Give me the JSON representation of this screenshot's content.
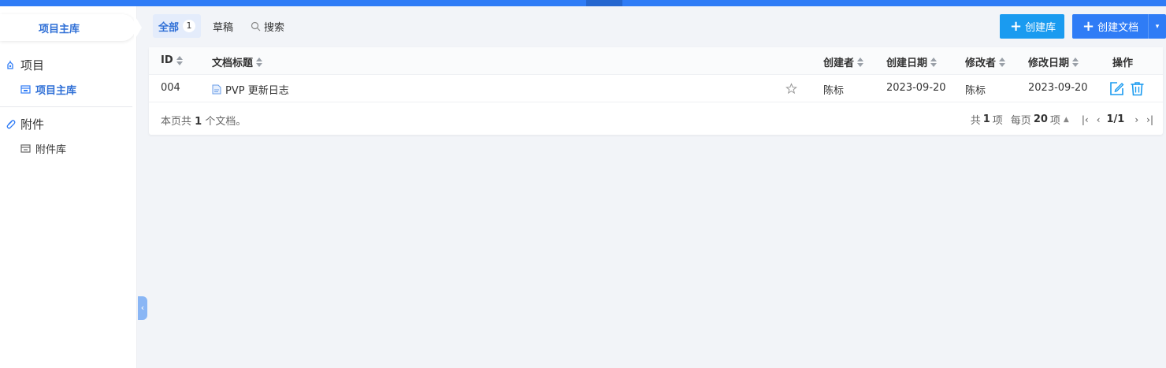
{
  "colors": {
    "accent": "#2f7cf6",
    "link": "#2f6fd6",
    "button": "#1a9bf0"
  },
  "sidebar": {
    "library_tab": "项目主库",
    "groups": [
      {
        "label": "项目",
        "icon": "project-icon",
        "items": [
          {
            "label": "项目主库",
            "icon": "library-icon",
            "active": true
          }
        ]
      },
      {
        "label": "附件",
        "icon": "paperclip-icon",
        "items": [
          {
            "label": "附件库",
            "icon": "attachment-library-icon",
            "active": false
          }
        ]
      }
    ],
    "collapse_glyph": "‹"
  },
  "tabs": [
    {
      "label": "全部",
      "count": "1",
      "active": true
    },
    {
      "label": "草稿"
    },
    {
      "label": "搜索",
      "icon": "search-icon"
    }
  ],
  "buttons": {
    "create_library": "创建库",
    "create_doc": "创建文档",
    "plus": "+",
    "dropdown": "▾"
  },
  "table": {
    "columns": [
      "ID",
      "文档标题",
      "创建者",
      "创建日期",
      "修改者",
      "修改日期",
      "操作"
    ],
    "rows": [
      {
        "id": "004",
        "title": "PVP 更新日志",
        "creator": "陈标",
        "created": "2023-09-20",
        "modifier": "陈标",
        "modified": "2023-09-20"
      }
    ]
  },
  "footer": {
    "summary_prefix": "本页共",
    "summary_count": "1",
    "summary_suffix": "个文档。",
    "total_prefix": "共",
    "total_count": "1",
    "total_suffix": "项",
    "per_page_prefix": "每页",
    "per_page": "20",
    "per_page_suffix": "项",
    "per_page_caret": "▲",
    "page": "1/1",
    "first": "|‹",
    "prev": "‹",
    "next": "›",
    "last": "›|"
  }
}
